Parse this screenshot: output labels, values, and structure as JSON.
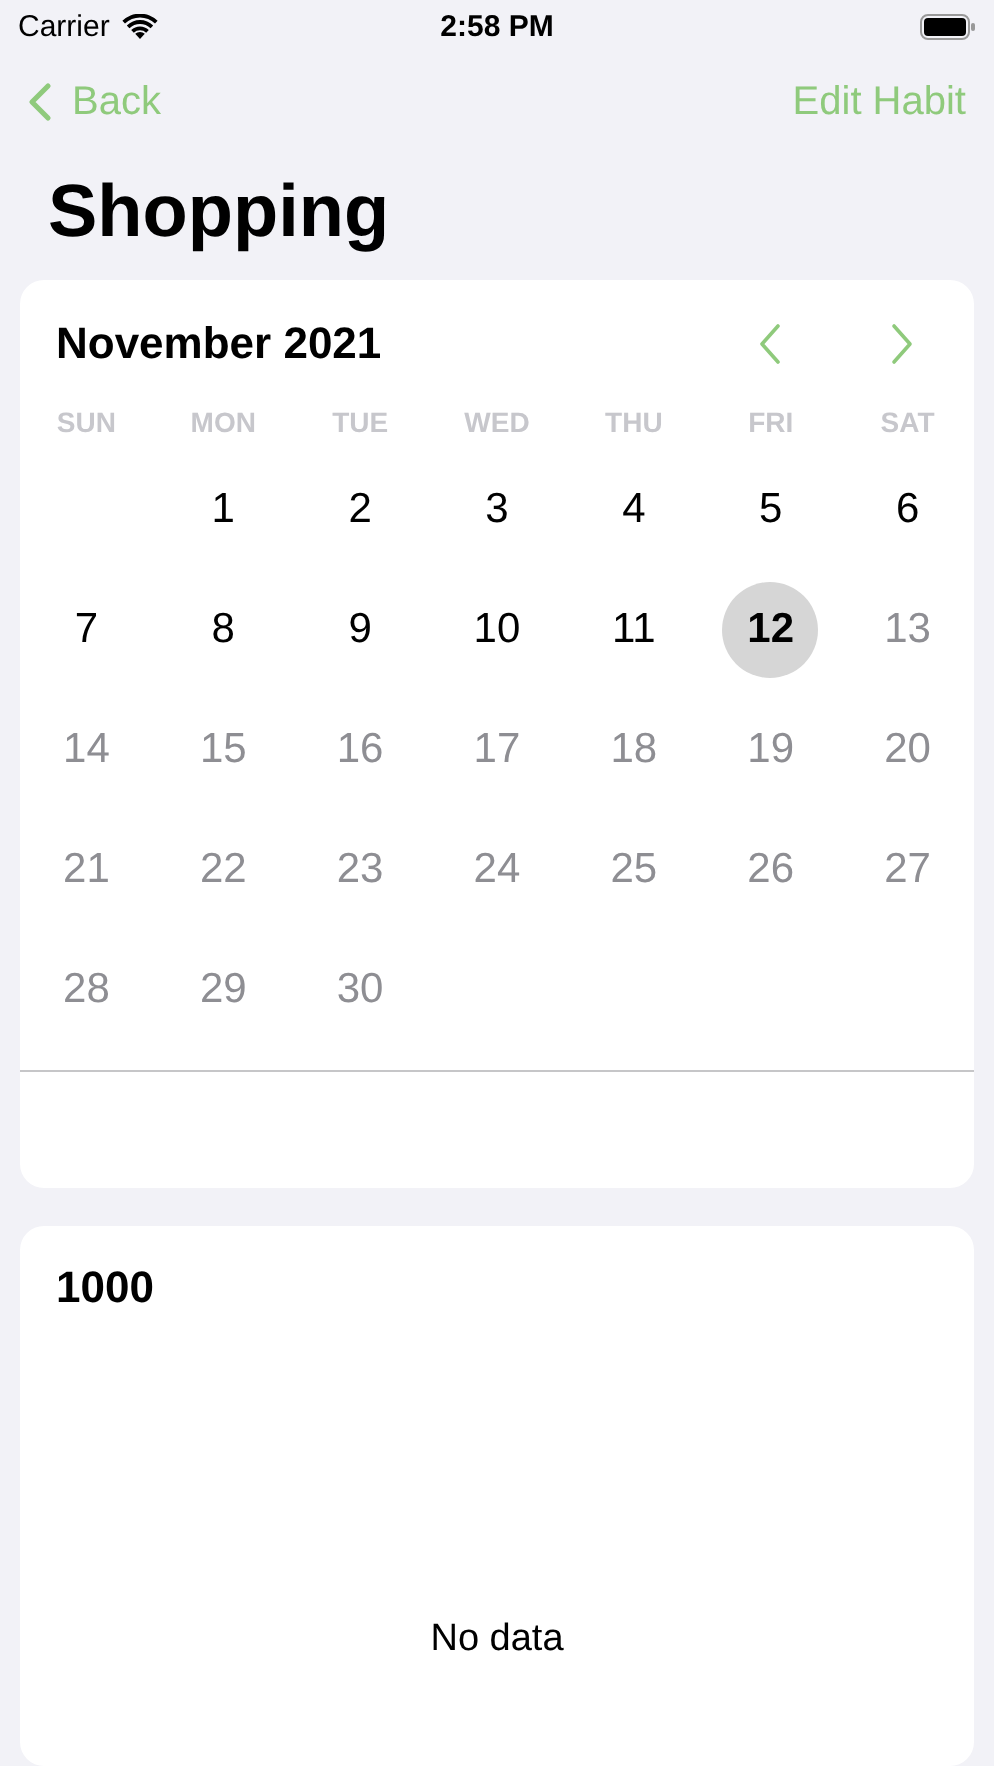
{
  "status_bar": {
    "carrier": "Carrier",
    "time": "2:58 PM"
  },
  "nav": {
    "back": "Back",
    "action": "Edit Habit"
  },
  "title": "Shopping",
  "calendar": {
    "month": "November 2021",
    "weekdays": [
      "SUN",
      "MON",
      "TUE",
      "WED",
      "THU",
      "FRI",
      "SAT"
    ],
    "days": [
      {
        "kind": "blank"
      },
      {
        "kind": "day",
        "label": "1",
        "dimmed": false,
        "selected": false
      },
      {
        "kind": "day",
        "label": "2",
        "dimmed": false,
        "selected": false
      },
      {
        "kind": "day",
        "label": "3",
        "dimmed": false,
        "selected": false
      },
      {
        "kind": "day",
        "label": "4",
        "dimmed": false,
        "selected": false
      },
      {
        "kind": "day",
        "label": "5",
        "dimmed": false,
        "selected": false
      },
      {
        "kind": "day",
        "label": "6",
        "dimmed": false,
        "selected": false
      },
      {
        "kind": "day",
        "label": "7",
        "dimmed": false,
        "selected": false
      },
      {
        "kind": "day",
        "label": "8",
        "dimmed": false,
        "selected": false
      },
      {
        "kind": "day",
        "label": "9",
        "dimmed": false,
        "selected": false
      },
      {
        "kind": "day",
        "label": "10",
        "dimmed": false,
        "selected": false
      },
      {
        "kind": "day",
        "label": "11",
        "dimmed": false,
        "selected": false
      },
      {
        "kind": "day",
        "label": "12",
        "dimmed": false,
        "selected": true
      },
      {
        "kind": "day",
        "label": "13",
        "dimmed": true,
        "selected": false
      },
      {
        "kind": "day",
        "label": "14",
        "dimmed": true,
        "selected": false
      },
      {
        "kind": "day",
        "label": "15",
        "dimmed": true,
        "selected": false
      },
      {
        "kind": "day",
        "label": "16",
        "dimmed": true,
        "selected": false
      },
      {
        "kind": "day",
        "label": "17",
        "dimmed": true,
        "selected": false
      },
      {
        "kind": "day",
        "label": "18",
        "dimmed": true,
        "selected": false
      },
      {
        "kind": "day",
        "label": "19",
        "dimmed": true,
        "selected": false
      },
      {
        "kind": "day",
        "label": "20",
        "dimmed": true,
        "selected": false
      },
      {
        "kind": "day",
        "label": "21",
        "dimmed": true,
        "selected": false
      },
      {
        "kind": "day",
        "label": "22",
        "dimmed": true,
        "selected": false
      },
      {
        "kind": "day",
        "label": "23",
        "dimmed": true,
        "selected": false
      },
      {
        "kind": "day",
        "label": "24",
        "dimmed": true,
        "selected": false
      },
      {
        "kind": "day",
        "label": "25",
        "dimmed": true,
        "selected": false
      },
      {
        "kind": "day",
        "label": "26",
        "dimmed": true,
        "selected": false
      },
      {
        "kind": "day",
        "label": "27",
        "dimmed": true,
        "selected": false
      },
      {
        "kind": "day",
        "label": "28",
        "dimmed": true,
        "selected": false
      },
      {
        "kind": "day",
        "label": "29",
        "dimmed": true,
        "selected": false
      },
      {
        "kind": "day",
        "label": "30",
        "dimmed": true,
        "selected": false
      }
    ]
  },
  "stats": {
    "heading": "1000",
    "empty_message": "No data"
  }
}
